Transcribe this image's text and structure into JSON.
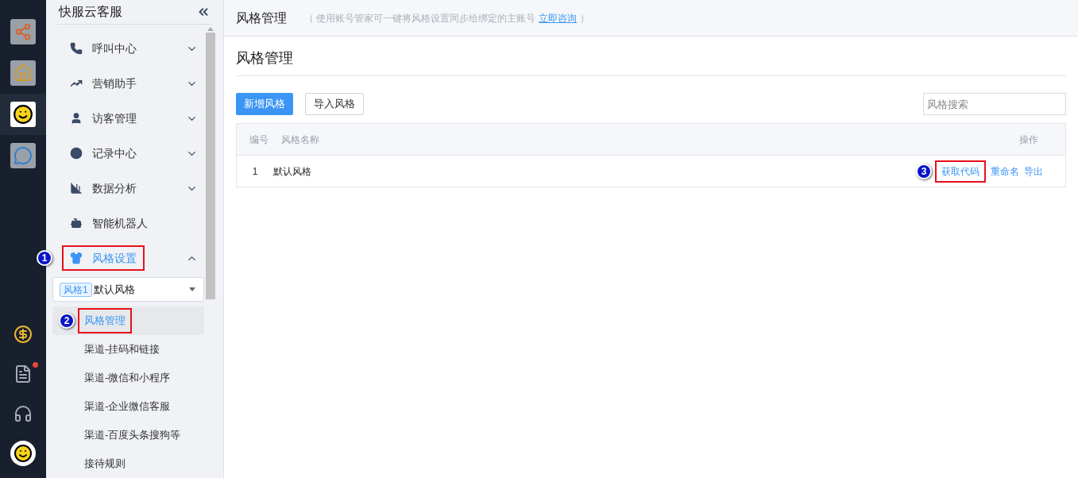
{
  "rail": {
    "top_items": [
      {
        "selected": false
      },
      {
        "selected": false
      },
      {
        "selected": true
      },
      {
        "selected": false
      }
    ],
    "bottom_items": [
      {
        "notification": false
      },
      {
        "notification": true
      },
      {
        "notification": false
      },
      {
        "notification": false
      }
    ]
  },
  "sidebar": {
    "title": "快服云客服",
    "items": [
      {
        "kind": "group",
        "label": "呼叫中心",
        "expanded": false,
        "selected": false
      },
      {
        "kind": "group",
        "label": "营销助手",
        "expanded": false,
        "selected": false
      },
      {
        "kind": "group",
        "label": "访客管理",
        "expanded": false,
        "selected": false
      },
      {
        "kind": "group",
        "label": "记录中心",
        "expanded": false,
        "selected": false
      },
      {
        "kind": "group",
        "label": "数据分析",
        "expanded": false,
        "selected": false
      },
      {
        "kind": "link",
        "label": "智能机器人",
        "selected": false
      },
      {
        "kind": "group",
        "label": "风格设置",
        "expanded": true,
        "selected": true,
        "callout": "1",
        "style_select": {
          "tag": "风格1",
          "value": "默认风格"
        },
        "children": [
          {
            "label": "风格管理",
            "selected": true,
            "callout": "2"
          },
          {
            "label": "渠道-挂码和链接",
            "selected": false
          },
          {
            "label": "渠道-微信和小程序",
            "selected": false
          },
          {
            "label": "渠道-企业微信客服",
            "selected": false
          },
          {
            "label": "渠道-百度头条搜狗等",
            "selected": false
          },
          {
            "label": "接待规则",
            "selected": false
          }
        ]
      }
    ]
  },
  "header": {
    "title": "风格管理",
    "note_open": "（ 使用账号管家可一键将风格设置同步给绑定的主账号",
    "link": "立即咨询",
    "note_close": "）"
  },
  "page": {
    "heading": "风格管理",
    "buttons": [
      {
        "kind": "primary",
        "label": "新增风格"
      },
      {
        "kind": "default",
        "label": "导入风格"
      }
    ],
    "search": {
      "placeholder": "风格搜索"
    },
    "table": {
      "columns": [
        "编号",
        "风格名称",
        "操作"
      ],
      "rows": [
        {
          "number": "1",
          "name": "默认风格",
          "actions": [
            {
              "label": "获取代码",
              "callout": "3"
            },
            {
              "label": "重命名"
            },
            {
              "label": "导出"
            }
          ]
        }
      ]
    }
  }
}
